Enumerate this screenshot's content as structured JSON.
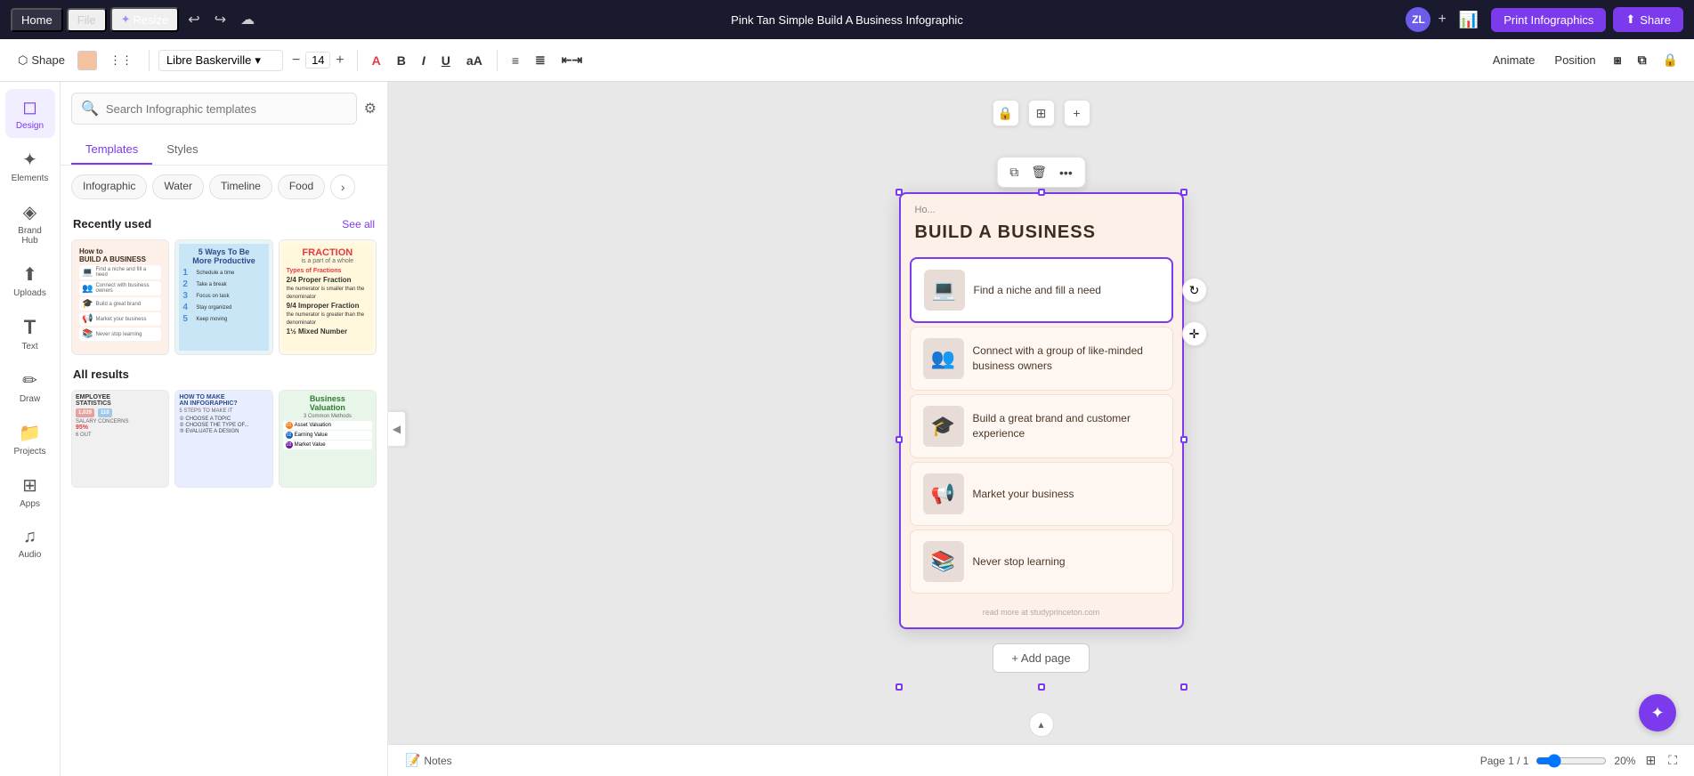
{
  "topNav": {
    "tabs": [
      "Home",
      "File",
      "Resize"
    ],
    "activeTab": "Home",
    "title": "Pink Tan Simple Build A Business Infographic",
    "user": "ZL",
    "printLabel": "Print Infographics",
    "shareLabel": "Share"
  },
  "toolbar": {
    "shapeLabel": "Shape",
    "fontName": "Libre Baskerville",
    "fontSize": "14",
    "animateLabel": "Animate",
    "positionLabel": "Position"
  },
  "sidebar": {
    "items": [
      {
        "label": "Design",
        "icon": "◻"
      },
      {
        "label": "Elements",
        "icon": "✦"
      },
      {
        "label": "Brand Hub",
        "icon": "◈"
      },
      {
        "label": "Uploads",
        "icon": "⬆"
      },
      {
        "label": "Text",
        "icon": "T"
      },
      {
        "label": "Draw",
        "icon": "✏"
      },
      {
        "label": "Projects",
        "icon": "📁"
      },
      {
        "label": "Apps",
        "icon": "⊞"
      },
      {
        "label": "Audio",
        "icon": "♫"
      }
    ],
    "activeItem": "Design"
  },
  "panel": {
    "searchPlaceholder": "Search Infographic templates",
    "tabs": [
      "Templates",
      "Styles"
    ],
    "activeTab": "Templates",
    "chips": [
      "Infographic",
      "Water",
      "Timeline",
      "Food"
    ],
    "recentlyUsedLabel": "Recently used",
    "seeAllLabel": "See all",
    "allResultsLabel": "All results",
    "templates": [
      {
        "title": "How to BUILD A BUSINESS",
        "bg": "#fdf0e8"
      },
      {
        "title": "5 Ways To Be More Productive",
        "bg": "#d4eaf7"
      },
      {
        "title": "FRACTION",
        "bg": "#fff9e0"
      }
    ],
    "results": [
      {
        "title": "EMPLOYEE STATISTICS",
        "bg": "#f5f5f5"
      },
      {
        "title": "HOW TO MAKE AN INFOGRAPHIC?",
        "bg": "#e8f0ff"
      },
      {
        "title": "Business Valuation",
        "bg": "#f0f8ee"
      }
    ]
  },
  "canvas": {
    "infographic": {
      "headerText": "Ho...",
      "title": "BUILD A BUSINESS",
      "steps": [
        {
          "text": "Find a niche and fill a need",
          "icon": "💻"
        },
        {
          "text": "Connect with a group of like-minded business owners",
          "icon": "👥"
        },
        {
          "text": "Build a great brand and customer experience",
          "icon": "🎓"
        },
        {
          "text": "Market your business",
          "icon": "📢"
        },
        {
          "text": "Never stop learning",
          "icon": "📚"
        }
      ],
      "footer": "read more at studyprinceton.com",
      "addPageLabel": "+ Add page"
    }
  },
  "bottomBar": {
    "pageInfo": "Page 1 / 1",
    "zoom": "20%"
  },
  "icons": {
    "search": "🔍",
    "filter": "⚙",
    "undo": "↩",
    "redo": "↪",
    "cloud": "☁",
    "bold": "B",
    "italic": "I",
    "underline": "U",
    "aa": "aA",
    "align": "≡",
    "list": "≣",
    "copy": "⧉",
    "trash": "🗑",
    "more": "•••",
    "lock": "🔒",
    "duplicate": "⊞",
    "add": "+",
    "rotate": "↻",
    "move": "✛",
    "collapse": "◀",
    "chevronDown": "▾",
    "minus": "−",
    "plus": "+",
    "gridView": "⊞",
    "fullscreen": "⛶",
    "scrollUp": "▴",
    "help": "✦",
    "notes": "📝",
    "colorPicker": "A",
    "lock2": "🔒",
    "resize2": "⧉"
  }
}
